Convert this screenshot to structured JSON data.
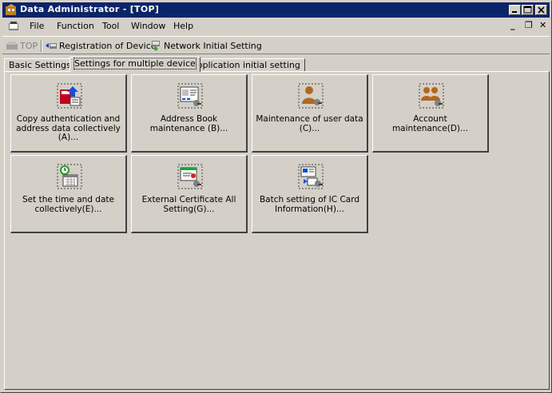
{
  "window": {
    "title": "Data Administrator - [TOP]"
  },
  "menu": {
    "file": "File",
    "function": "Function",
    "tool": "Tool",
    "window": "Window",
    "help": "Help"
  },
  "toolbar": {
    "top": "TOP",
    "registration": "Registration of Device",
    "network": "Network Initial Setting"
  },
  "tabs": [
    "Basic Settings",
    "Settings for multiple device",
    "Application initial setting"
  ],
  "tiles": [
    {
      "label": "Copy authentication and address data collectively (A)...",
      "icon": "copy-data-icon"
    },
    {
      "label": "Address Book maintenance (B)...",
      "icon": "address-book-icon"
    },
    {
      "label": "Maintenance of user data (C)...",
      "icon": "user-data-icon"
    },
    {
      "label": "Account maintenance(D)...",
      "icon": "account-icon"
    },
    {
      "label": "Set the time and date collectively(E)...",
      "icon": "clock-calendar-icon"
    },
    {
      "label": "External Certificate All Setting(G)...",
      "icon": "certificate-icon"
    },
    {
      "label": "Batch setting of IC Card Information(H)...",
      "icon": "ic-card-icon"
    }
  ]
}
